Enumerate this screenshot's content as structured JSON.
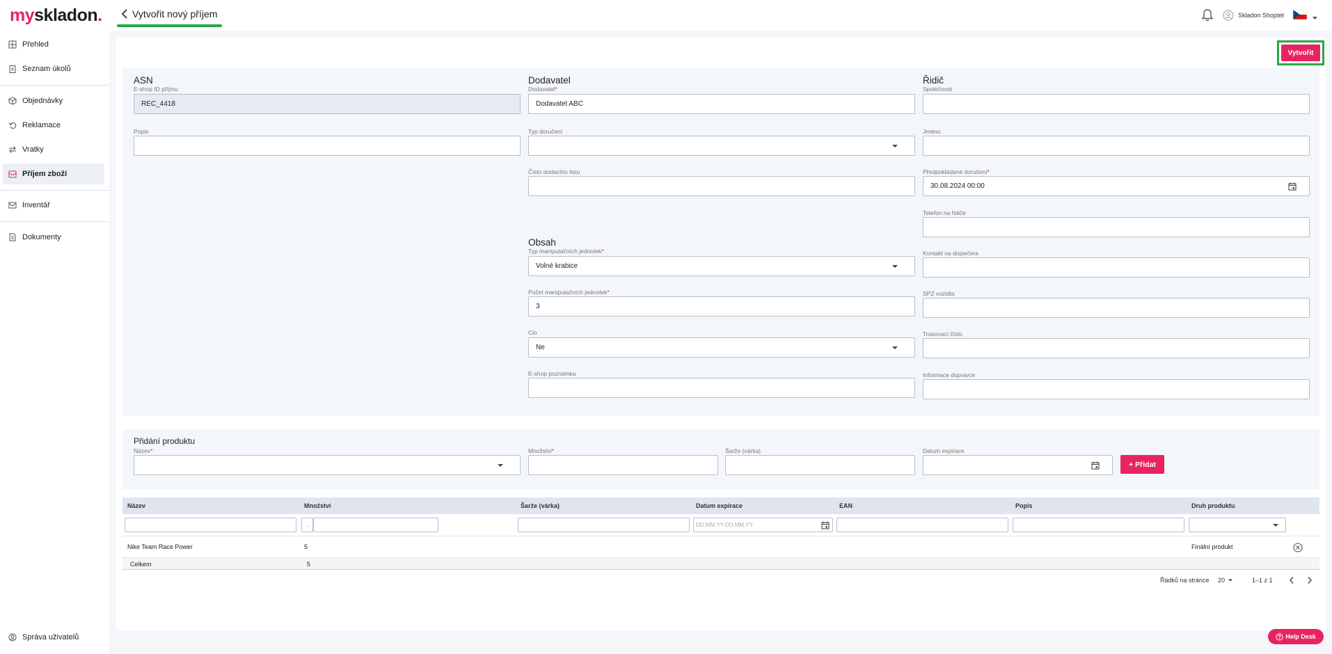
{
  "brand": {
    "my": "my",
    "skladon": "skladon",
    "dot": "."
  },
  "header": {
    "title": "Vytvořit nový příjem",
    "user_name": "Skladon Shoptet",
    "colors": {
      "accent": "#e8245f",
      "highlight": "#28a745"
    }
  },
  "sidebar": {
    "items": [
      {
        "label": "Přehled",
        "icon": "grid-icon"
      },
      {
        "label": "Seznam úkolů",
        "icon": "clipboard-icon"
      },
      {
        "label": "Objednávky",
        "icon": "box-icon"
      },
      {
        "label": "Reklamace",
        "icon": "return-icon"
      },
      {
        "label": "Vratky",
        "icon": "swap-icon"
      },
      {
        "label": "Příjem zboží",
        "icon": "receive-icon",
        "active": true
      },
      {
        "label": "Inventář",
        "icon": "inbox-icon"
      },
      {
        "label": "Dokumenty",
        "icon": "document-icon"
      }
    ],
    "bottom_item": {
      "label": "Správa uživatelů",
      "icon": "users-icon"
    }
  },
  "actions": {
    "create": "Vytvořit"
  },
  "asn": {
    "title": "ASN",
    "eshop_id_label": "E-shop ID příjmu",
    "eshop_id_value": "REC_4418",
    "popis_label": "Popis",
    "popis_value": ""
  },
  "dodavatel": {
    "title": "Dodavatel",
    "dodavatel_label": "Dodavatel",
    "dodavatel_value": "Dodavatel ABC",
    "typ_doruceni_label": "Typ doručení",
    "typ_doruceni_value": "",
    "cislo_listu_label": "Číslo dodacího listu",
    "cislo_listu_value": ""
  },
  "obsah": {
    "title": "Obsah",
    "typ_jednotek_label": "Typ manipulačních jednotek",
    "typ_jednotek_value": "Volné krabice",
    "pocet_jednotek_label": "Počet manipulačních jednotek",
    "pocet_jednotek_value": "3",
    "clo_label": "Clo",
    "clo_value": "Ne",
    "poznamka_label": "E-shop poznámka",
    "poznamka_value": ""
  },
  "ridic": {
    "title": "Řidič",
    "spolecnost_label": "Společnost",
    "jmeno_label": "Jméno",
    "predpokladane_label": "Předpokládané doručení",
    "predpokladane_value": "30.08.2024 00:00",
    "telefon_label": "Telefon na řidiče",
    "kontakt_label": "Kontakt na dispečera",
    "spz_label": "SPZ vozidla",
    "trasovaci_label": "Trasovací číslo",
    "informace_label": "Informace dopravce"
  },
  "pridani": {
    "title": "Přidání produktu",
    "nazev_label": "Název",
    "mnozstvi_label": "Množství",
    "sarze_label": "Šarže (várka)",
    "expirace_label": "Datum expirace",
    "add_button": "+ Přidat"
  },
  "table": {
    "columns": [
      "Název",
      "Množství",
      "Šarže (várka)",
      "Datum expirace",
      "EAN",
      "Popis",
      "Druh produktu"
    ],
    "date_filter_placeholder": "DD.MM.YY-DD.MM.YY",
    "range_prefix": "...",
    "rows": [
      {
        "nazev": "Nike Team Race Power",
        "mnozstvi": "5",
        "druh": "Finální produkt"
      }
    ],
    "total_label": "Celkem",
    "total_value": "5"
  },
  "pagination": {
    "rows_per_page_label": "Řádků na stránce",
    "rows_per_page_value": "20",
    "range": "1–1 z 1"
  },
  "help": {
    "label": "Help Desk"
  }
}
